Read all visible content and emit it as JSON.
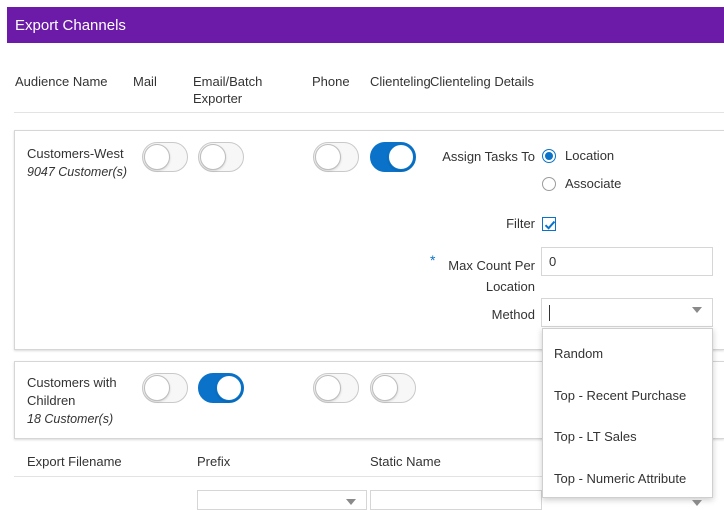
{
  "title": "Export Channels",
  "columns": {
    "audience_name": "Audience Name",
    "mail": "Mail",
    "email_batch_line1": "Email/Batch",
    "email_batch_line2": "Exporter",
    "phone": "Phone",
    "clienteling": "Clienteling",
    "clienteling_details": "Clienteling Details"
  },
  "audiences": [
    {
      "name": "Customers-West",
      "count": "9047 Customer(s)",
      "mail": false,
      "email": false,
      "phone": false,
      "clienteling": true
    },
    {
      "name_line1": "Customers with",
      "name_line2": "Children",
      "count": "18 Customer(s)",
      "mail": false,
      "email": true,
      "phone": false,
      "clienteling": false
    }
  ],
  "details": {
    "assign_tasks_label": "Assign Tasks To",
    "assign_options": [
      {
        "label": "Location",
        "selected": true
      },
      {
        "label": "Associate",
        "selected": false
      }
    ],
    "filter_label": "Filter",
    "filter_checked": true,
    "max_count_label_line1": "Max Count Per",
    "max_count_label_line2": "Location",
    "max_count_required_mark": "*",
    "max_count_value": "0",
    "method_label": "Method",
    "method_value": ""
  },
  "method_options": [
    "Random",
    "Top - Recent Purchase",
    "Top - LT Sales",
    "Top - Numeric Attribute"
  ],
  "export_headers": {
    "filename": "Export Filename",
    "prefix": "Prefix",
    "static_name": "Static Name"
  },
  "colors": {
    "title_bar": "#6c1ba8",
    "accent": "#0a73c9"
  }
}
